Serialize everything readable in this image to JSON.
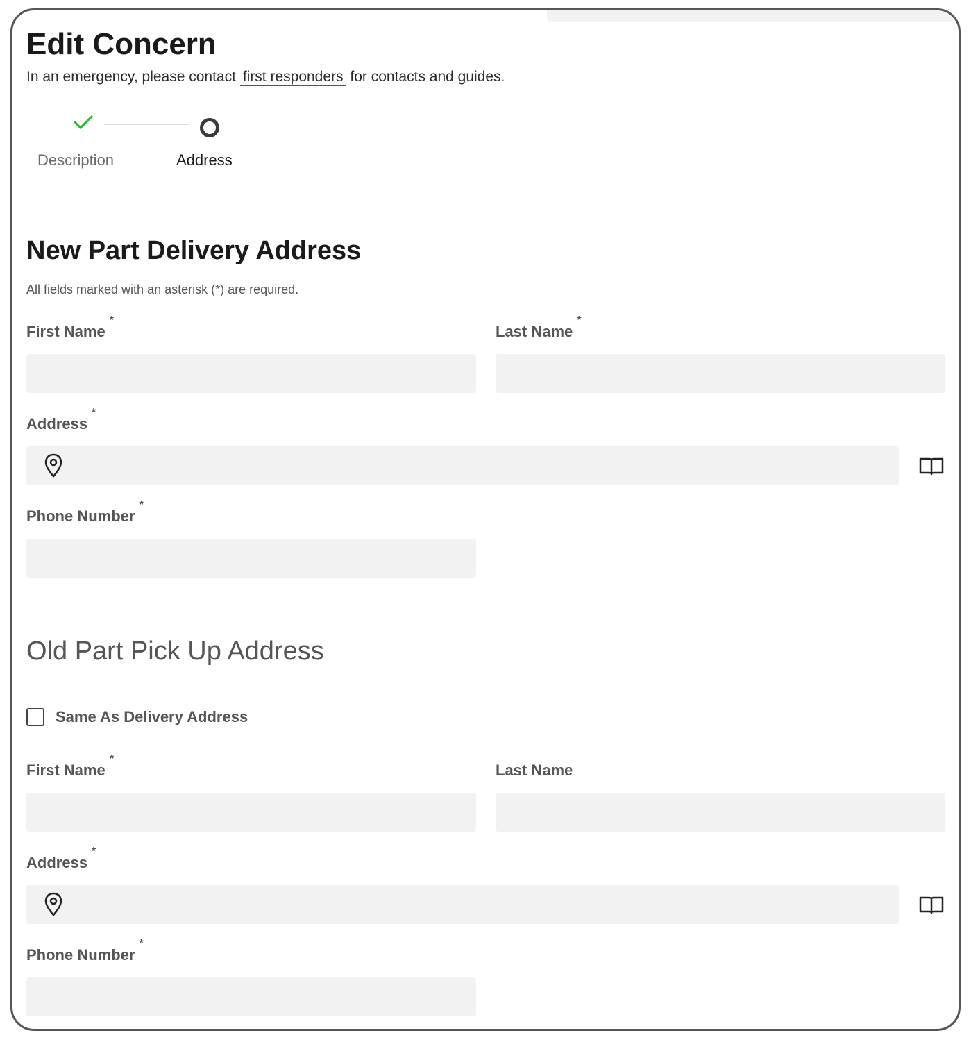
{
  "header": {
    "title": "Edit Concern",
    "subtitle_prefix": "In an emergency, please contact",
    "subtitle_link": "first responders",
    "subtitle_suffix": "for contacts and guides."
  },
  "stepper": {
    "steps": [
      {
        "label": "Description",
        "state": "done"
      },
      {
        "label": "Address",
        "state": "current"
      }
    ],
    "done_color": "#2bb52b"
  },
  "delivery": {
    "heading": "New Part Delivery Address",
    "hint": "All fields marked with an asterisk (*) are required.",
    "first_name_label": "First Name",
    "last_name_label": "Last Name",
    "address_label": "Address",
    "phone_label": "Phone Number",
    "required_mark": "*",
    "first_name_value": "",
    "last_name_value": "",
    "address_value": "",
    "phone_value": ""
  },
  "pickup": {
    "heading": "Old Part Pick Up Address",
    "same_as_label": "Same As Delivery Address",
    "same_as_checked": false,
    "first_name_label": "First Name",
    "last_name_label": "Last Name",
    "address_label": "Address",
    "phone_label": "Phone Number",
    "required_mark": "*",
    "first_name_value": "",
    "last_name_value": "",
    "address_value": "",
    "phone_value": ""
  },
  "icons": {
    "location": "map-pin-icon",
    "address_book": "address-book-icon",
    "step_done": "checkmark-icon",
    "step_current": "circle-icon"
  }
}
